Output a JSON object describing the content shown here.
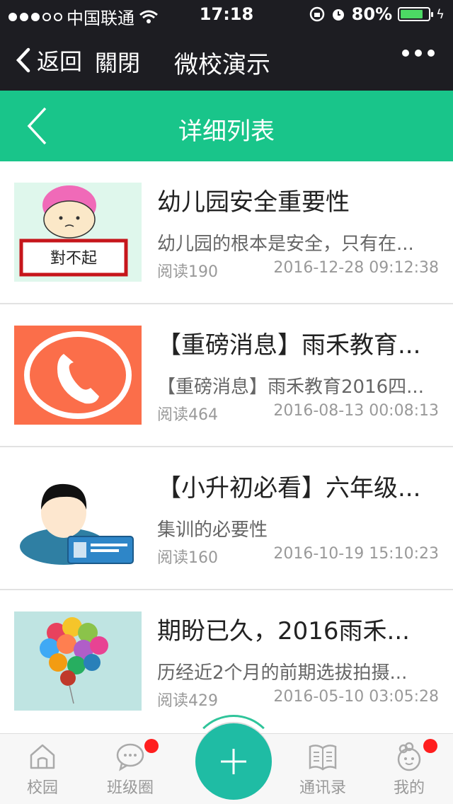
{
  "status_bar": {
    "carrier": "中国联通",
    "time": "17:18",
    "battery_percent": "80%",
    "signal_bars_filled": 3,
    "signal_bars_total": 5,
    "battery_level": 0.8
  },
  "wechat_nav": {
    "back_label": "返回",
    "close_label": "關閉",
    "title": "微校演示"
  },
  "page_header": {
    "title": "详细列表"
  },
  "articles": [
    {
      "title": "幼儿园安全重要性",
      "summary": "幼儿园的根本是安全，只有在...",
      "reads": "阅读190",
      "date": "2016-12-28 09:12:38",
      "thumb_text": "對不起"
    },
    {
      "title": "【重磅消息】雨禾教育...",
      "summary": "【重磅消息】雨禾教育2016四...",
      "reads": "阅读464",
      "date": "2016-08-13 00:08:13"
    },
    {
      "title": "【小升初必看】六年级...",
      "summary": "集训的必要性",
      "reads": "阅读160",
      "date": "2016-10-19 15:10:23"
    },
    {
      "title": "期盼已久，2016雨禾...",
      "summary": "历经近2个月的前期选拔拍摄...",
      "reads": "阅读429",
      "date": "2016-05-10 03:05:28"
    }
  ],
  "tabbar": {
    "campus": "校园",
    "class_circle": "班级圈",
    "contacts": "通讯录",
    "mine": "我的"
  },
  "colors": {
    "accent_green": "#19c58a",
    "fab_teal": "#1fbca4",
    "badge_red": "#ff1e1e",
    "dark_bar": "#1d1d22"
  }
}
